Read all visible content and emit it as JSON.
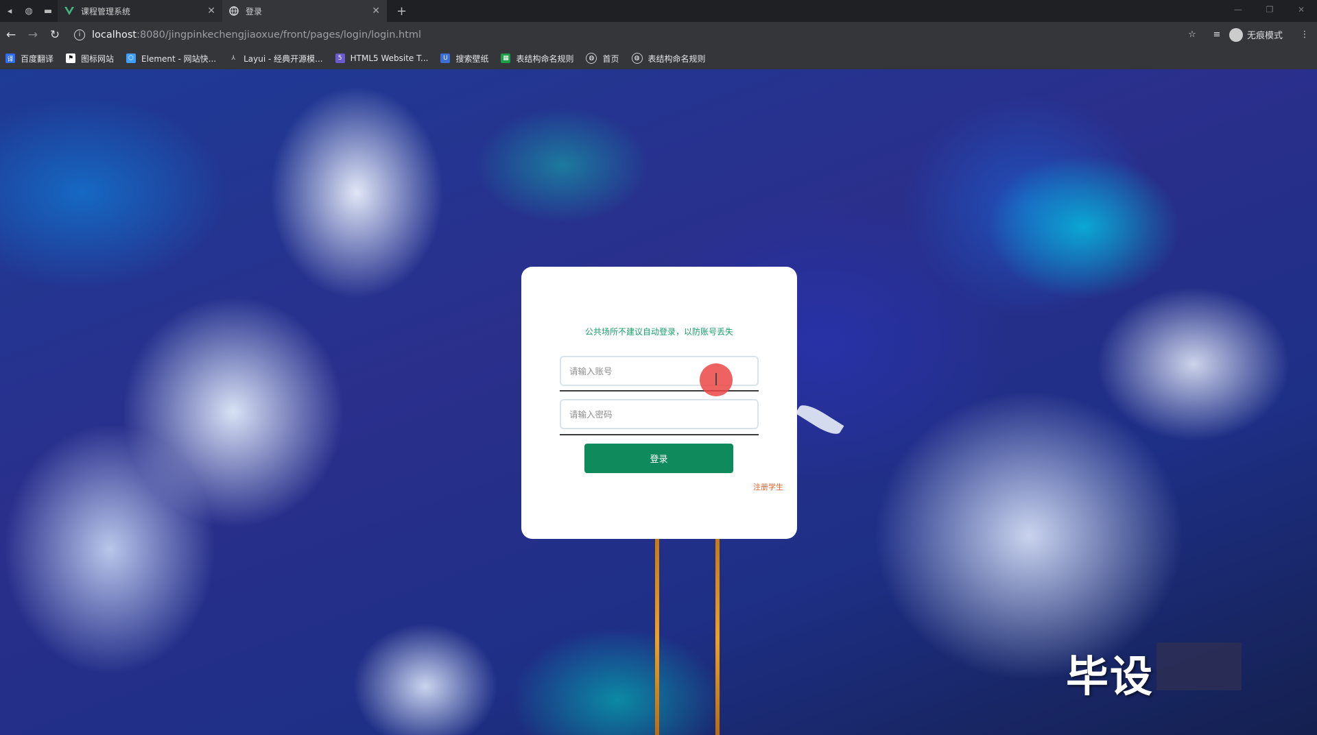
{
  "browser": {
    "tabs": [
      {
        "title": "课程管理系统",
        "icon": "vue-logo-icon",
        "active": false
      },
      {
        "title": "登录",
        "icon": "globe-icon",
        "active": true
      }
    ],
    "url_host": "localhost",
    "url_rest": ":8080/jingpinkechengjiaoxue/front/pages/login/login.html",
    "profile_label": "无痕模式",
    "bookmarks": [
      {
        "label": "百度翻译",
        "icon": "translate-icon",
        "color": "#2f6bff"
      },
      {
        "label": "图标网站",
        "icon": "flag-icon",
        "color": "#222222"
      },
      {
        "label": "Element - 网站快...",
        "icon": "element-icon",
        "color": "#409eff"
      },
      {
        "label": "Layui - 经典开源模...",
        "icon": "layui-icon",
        "color": "#555555"
      },
      {
        "label": "HTML5 Website T...",
        "icon": "html5-icon",
        "color": "#6a5acd"
      },
      {
        "label": "搜索壁纸",
        "icon": "wallpaper-icon",
        "color": "#3a6fd8"
      },
      {
        "label": "表结构命名规则",
        "icon": "sheet-icon",
        "color": "#1e9e4a"
      },
      {
        "label": "首页",
        "icon": "globe-icon",
        "color": "#555555"
      },
      {
        "label": "表结构命名规则",
        "icon": "globe-icon",
        "color": "#555555"
      }
    ]
  },
  "login": {
    "notice": "公共场所不建议自动登录，以防账号丢失",
    "account_placeholder": "请输入账号",
    "password_placeholder": "请输入密码",
    "login_button": "登录",
    "register_link": "注册学生"
  },
  "watermark": "毕设",
  "colors": {
    "accent": "#0f8a5c",
    "notice": "#1a9e6a",
    "register": "#e0602a"
  }
}
